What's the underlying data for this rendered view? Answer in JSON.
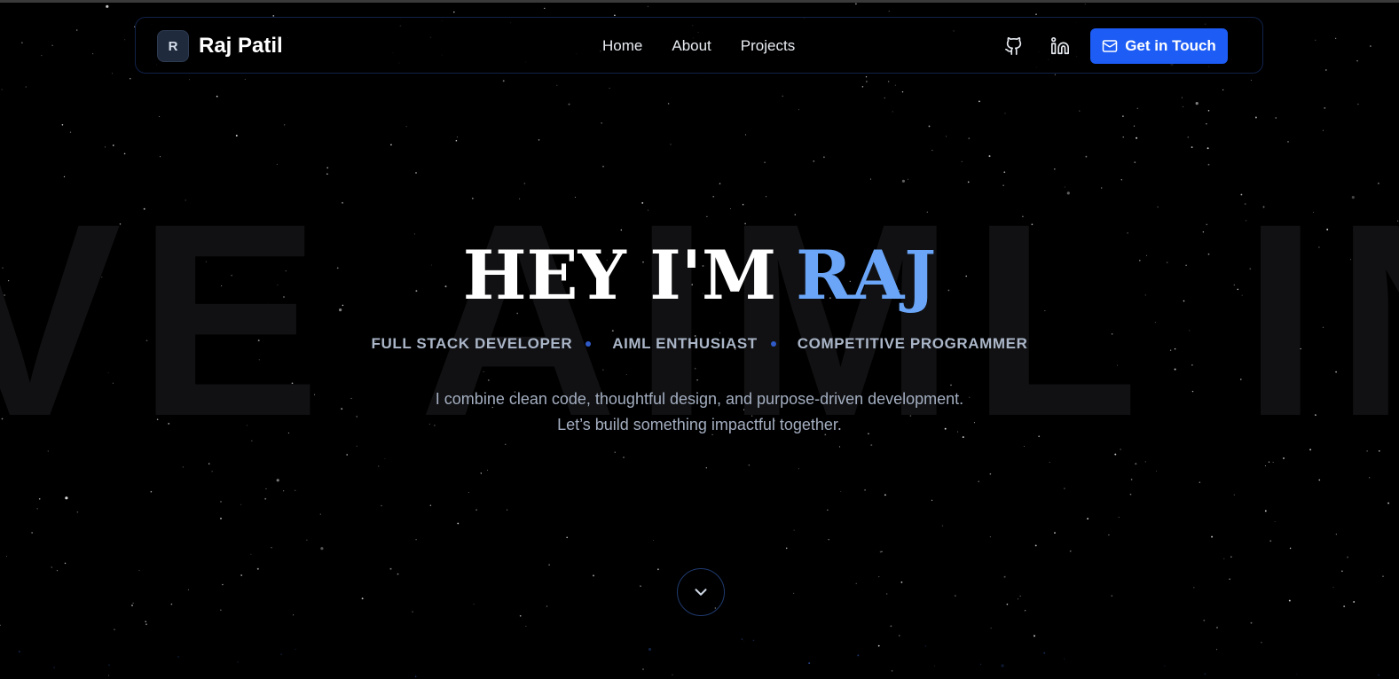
{
  "brand": {
    "logo_letter": "R",
    "name": "Raj Patil"
  },
  "nav": {
    "links": [
      {
        "label": "Home"
      },
      {
        "label": "About"
      },
      {
        "label": "Projects"
      }
    ],
    "icons": [
      "github-icon",
      "linkedin-icon"
    ],
    "cta_label": "Get in Touch",
    "cta_icon": "mail-icon"
  },
  "hero": {
    "background_word": "VE AIML INN",
    "title_prefix": "HEY I'M",
    "title_name": "RAJ",
    "roles": [
      "FULL STACK DEVELOPER",
      "AIML ENTHUSIAST",
      "COMPETITIVE PROGRAMMER"
    ],
    "tagline_line1": "I combine clean code, thoughtful design, and purpose-driven development.",
    "tagline_line2": "Let’s build something impactful together.",
    "scroll_icon": "chevron-down-icon"
  },
  "colors": {
    "background": "#000000",
    "accent": "#1d5cf5",
    "name_gradient": "#6aa5f7",
    "navbar_border": "#10224a"
  }
}
